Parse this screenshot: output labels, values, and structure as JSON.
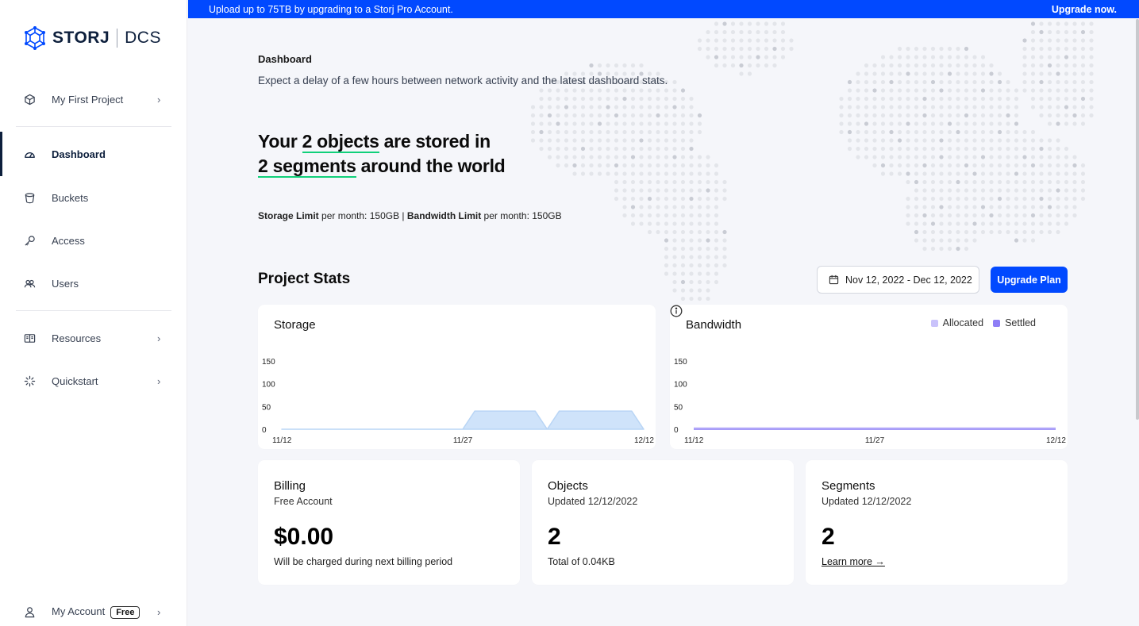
{
  "app": {
    "brand": "STORJ",
    "product": "DCS"
  },
  "banner": {
    "message": "Upload up to 75TB by upgrading to a Storj Pro Account.",
    "cta": "Upgrade now."
  },
  "sidebar": {
    "project": {
      "label": "My First Project",
      "icon": "cube-icon"
    },
    "items": [
      {
        "label": "Dashboard",
        "icon": "gauge-icon",
        "active": true
      },
      {
        "label": "Buckets",
        "icon": "bucket-icon"
      },
      {
        "label": "Access",
        "icon": "key-icon"
      },
      {
        "label": "Users",
        "icon": "users-icon"
      },
      {
        "label": "Resources",
        "icon": "resources-icon"
      },
      {
        "label": "Quickstart",
        "icon": "spinner-icon"
      }
    ],
    "account": {
      "label": "My Account",
      "badge": "Free",
      "icon": "user-icon"
    }
  },
  "main": {
    "breadcrumb": "Dashboard",
    "delay_notice": "Expect a delay of a few hours between network activity and the latest dashboard stats.",
    "headline": {
      "part1": "Your ",
      "objects": "2 objects",
      "part2": " are stored in",
      "segments": "2 segments",
      "part3": " around the world"
    },
    "limits": {
      "storage_label": "Storage Limit",
      "storage_text": " per month: 150GB",
      "separator": " | ",
      "bandwidth_label": "Bandwidth Limit",
      "bandwidth_text": " per month: 150GB"
    },
    "stats_title": "Project Stats",
    "date_range": "Nov 12, 2022 - Dec 12, 2022",
    "upgrade_plan": "Upgrade Plan",
    "billing": {
      "title": "Billing",
      "subtitle": "Free Account",
      "value": "$0.00",
      "footer": "Will be charged during next billing period"
    },
    "objects": {
      "title": "Objects",
      "subtitle": "Updated 12/12/2022",
      "value": "2",
      "footer": "Total of 0.04KB"
    },
    "segments": {
      "title": "Segments",
      "subtitle": "Updated 12/12/2022",
      "value": "2",
      "footer": "Learn more →"
    }
  },
  "chart_data": [
    {
      "type": "area",
      "title": "Storage",
      "yticks": [
        "150",
        "100",
        "50",
        "0"
      ],
      "xticks": [
        "11/12",
        "11/27",
        "12/12"
      ],
      "ylim": [
        0,
        150
      ],
      "x": [
        0,
        1,
        2,
        3,
        4,
        5,
        6,
        7,
        8,
        9,
        10,
        11,
        12,
        13,
        14,
        15,
        16,
        17,
        18,
        19,
        20,
        21,
        22,
        23,
        24,
        25,
        26,
        27,
        28,
        29,
        30
      ],
      "series": [
        {
          "values": [
            0,
            0,
            0,
            0,
            0,
            0,
            0,
            0,
            0,
            0,
            0,
            0,
            0,
            0,
            0,
            0,
            40,
            40,
            40,
            40,
            40,
            40,
            0,
            40,
            40,
            40,
            40,
            40,
            40,
            40,
            0
          ]
        }
      ],
      "color": "#cfe3fa"
    },
    {
      "type": "line",
      "title": "Bandwidth",
      "yticks": [
        "150",
        "100",
        "50",
        "0"
      ],
      "xticks": [
        "11/12",
        "11/27",
        "12/12"
      ],
      "ylim": [
        0,
        150
      ],
      "legend": [
        {
          "name": "Allocated",
          "color": "#c9c2fb"
        },
        {
          "name": "Settled",
          "color": "#8e7ef6"
        }
      ],
      "legend_position": "top-right",
      "series": [
        {
          "name": "Allocated",
          "values": [
            0,
            0,
            0,
            0,
            0,
            0,
            0,
            0,
            0,
            0,
            0,
            0,
            0,
            0,
            0,
            0,
            0,
            0,
            0,
            0,
            0,
            0,
            0,
            0,
            0,
            0,
            0,
            0,
            0,
            0,
            0
          ]
        },
        {
          "name": "Settled",
          "values": [
            0,
            0,
            0,
            0,
            0,
            0,
            0,
            0,
            0,
            0,
            0,
            0,
            0,
            0,
            0,
            0,
            0,
            0,
            0,
            0,
            0,
            0,
            0,
            0,
            0,
            0,
            0,
            0,
            0,
            0,
            0
          ]
        }
      ]
    }
  ]
}
